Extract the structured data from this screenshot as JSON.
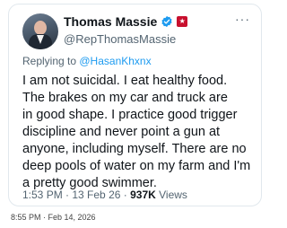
{
  "tweet": {
    "author_name": "Thomas Massie",
    "handle": "@RepThomasMassie",
    "verified_icon": "verified-badge-icon",
    "affiliation_icon": "us-flag-icon",
    "more_icon": "more-options-icon",
    "reply_prefix": "Replying to ",
    "reply_to": "@HasanKhxnx",
    "text": "I am not suicidal. I eat healthy food.\nThe brakes on my car and truck are\nin good shape. I practice good trigger\ndiscipline and never point a gun at\nanyone,  including myself. There are no\ndeep pools of water on my farm and I'm\na pretty good swimmer.",
    "time": "1:53 PM",
    "separator": " · ",
    "date": "13 Feb 26",
    "views_count": "937K",
    "views_label": " Views"
  },
  "screenshot_stamp": "8:55 PM · Feb 14, 2026",
  "colors": {
    "verified_blue": "#1d9bf0",
    "link_blue": "#1d9bf0",
    "muted_text": "#536471",
    "primary_text": "#0f1419",
    "border": "#e1e8ed"
  }
}
